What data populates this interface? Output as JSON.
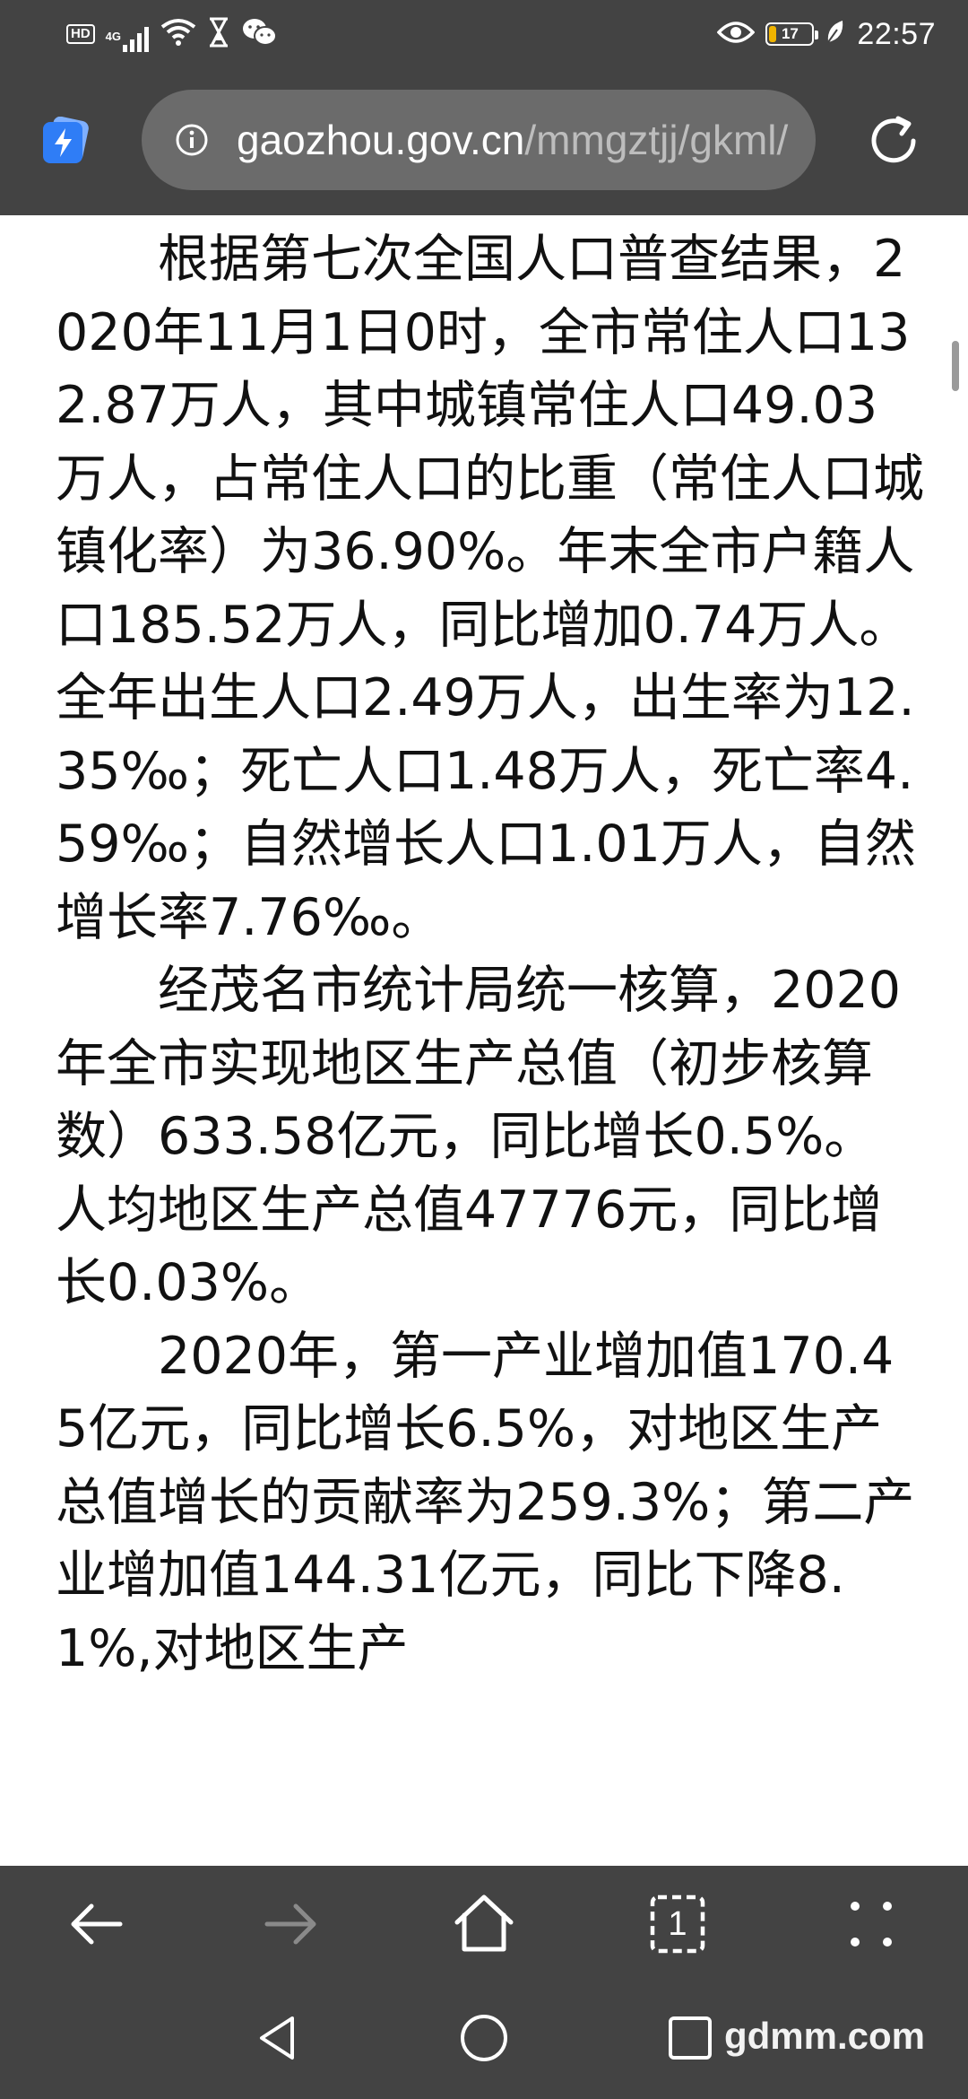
{
  "status_bar": {
    "hd_label": "HD",
    "network_label": "4G",
    "battery_level": "17",
    "battery_fraction": 0.17,
    "time": "22:57"
  },
  "address_bar": {
    "url_domain": "gaozhou.gov.cn",
    "url_path": "/mmgztjj/gkml/",
    "accent_color": "#2f7df6"
  },
  "article": {
    "paragraphs": [
      "根据第七次全国人口普查结果，2020年11月1日0时，全市常住人口132.87万人，其中城镇常住人口49.03万人，占常住人口的比重（常住人口城镇化率）为36.90%。年末全市户籍人口185.52万人，同比增加0.74万人。全年出生人口2.49万人，出生率为12.35‰；死亡人口1.48万人，死亡率4.59‰；自然增长人口1.01万人，自然增长率7.76‰。",
      "经茂名市统计局统一核算，2020年全市实现地区生产总值（初步核算数）633.58亿元，同比增长0.5%。人均地区生产总值47776元，同比增长0.03%。",
      "2020年，第一产业增加值170.45亿元，同比增长6.5%，对地区生产总值增长的贡献率为259.3%；第二产业增加值144.31亿元，同比下降8.1%,对地区生产"
    ]
  },
  "toolbar": {
    "icons": [
      "back-arrow-icon",
      "forward-arrow-icon",
      "home-icon",
      "tabs-icon",
      "more-icon"
    ],
    "tab_count": "1"
  },
  "nav_bar": {
    "icons": [
      "back-triangle-icon",
      "home-circle-icon",
      "recents-square-icon"
    ]
  },
  "watermark": "gdmm.com"
}
